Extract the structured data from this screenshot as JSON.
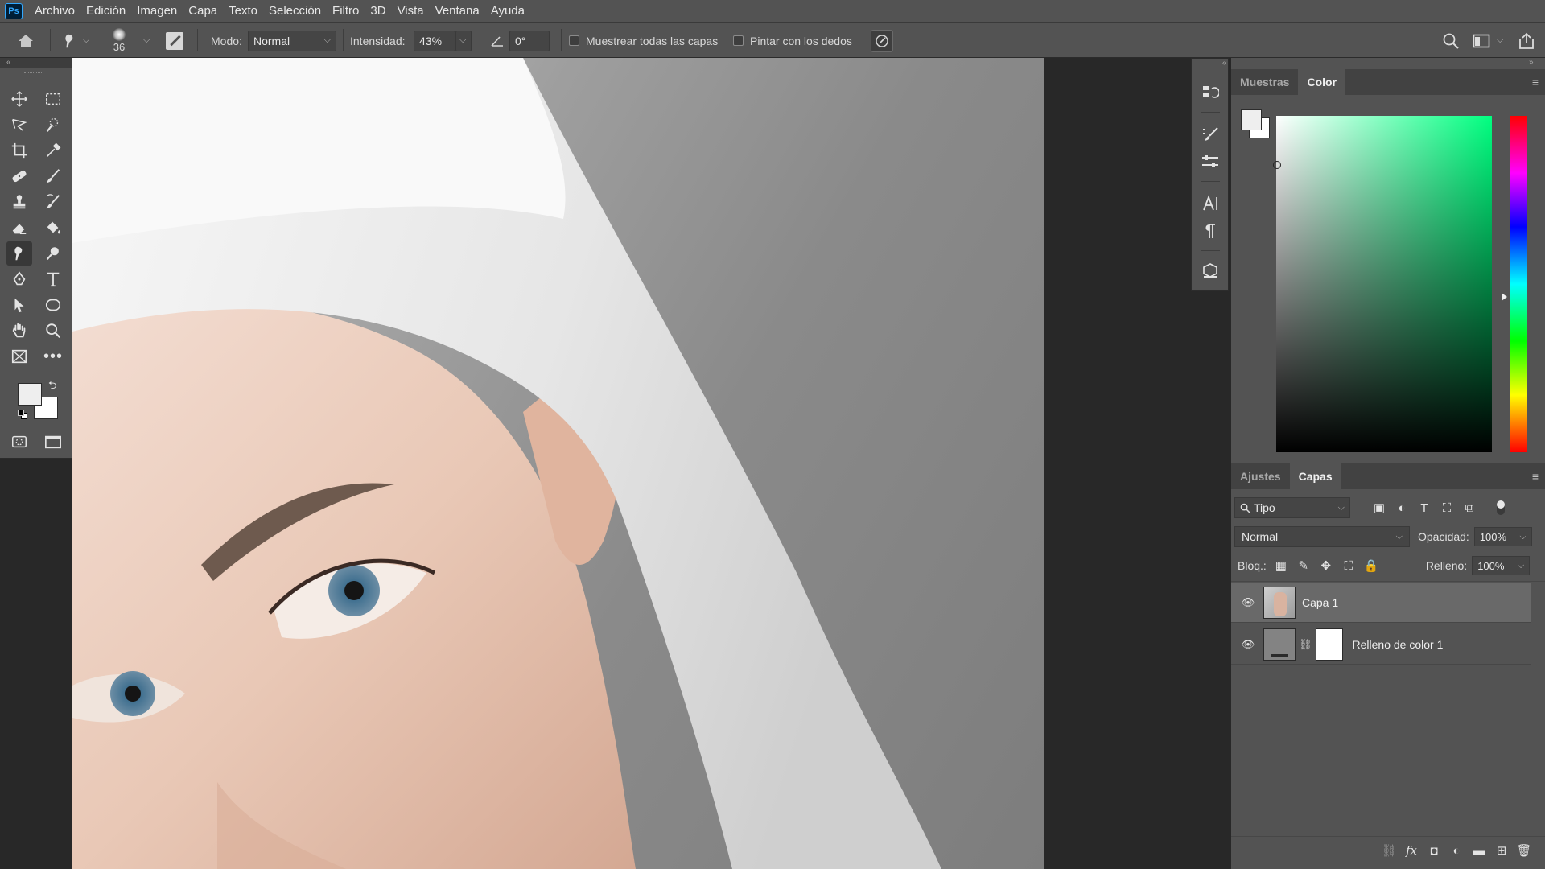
{
  "menubar": {
    "logo": "Ps",
    "items": [
      "Archivo",
      "Edición",
      "Imagen",
      "Capa",
      "Texto",
      "Selección",
      "Filtro",
      "3D",
      "Vista",
      "Ventana",
      "Ayuda"
    ]
  },
  "options": {
    "brush_size": "36",
    "mode_label": "Modo:",
    "mode_value": "Normal",
    "intensity_label": "Intensidad:",
    "intensity_value": "43%",
    "angle_value": "0°",
    "sample_all_layers": "Muestrear todas las capas",
    "finger_painting": "Pintar con los dedos"
  },
  "toolbar": {
    "active_tool": "smudge-tool",
    "foreground_color": "#eeeeee",
    "background_color": "#ffffff"
  },
  "color_panel": {
    "tabs": [
      "Muestras",
      "Color"
    ],
    "active_tab": "Color"
  },
  "layers_panel": {
    "tabs": [
      "Ajustes",
      "Capas"
    ],
    "active_tab": "Capas",
    "filter_kind": "Tipo",
    "blend_mode": "Normal",
    "opacity_label": "Opacidad:",
    "opacity_value": "100%",
    "lock_label": "Bloq.:",
    "fill_label": "Relleno:",
    "fill_value": "100%",
    "layers": [
      {
        "name": "Capa 1",
        "visible": true,
        "selected": true
      },
      {
        "name": "Relleno de color 1",
        "visible": true,
        "selected": false
      }
    ]
  },
  "colors": {
    "chrome": "#535353",
    "dark_chrome": "#424242",
    "workspace": "#282828"
  }
}
